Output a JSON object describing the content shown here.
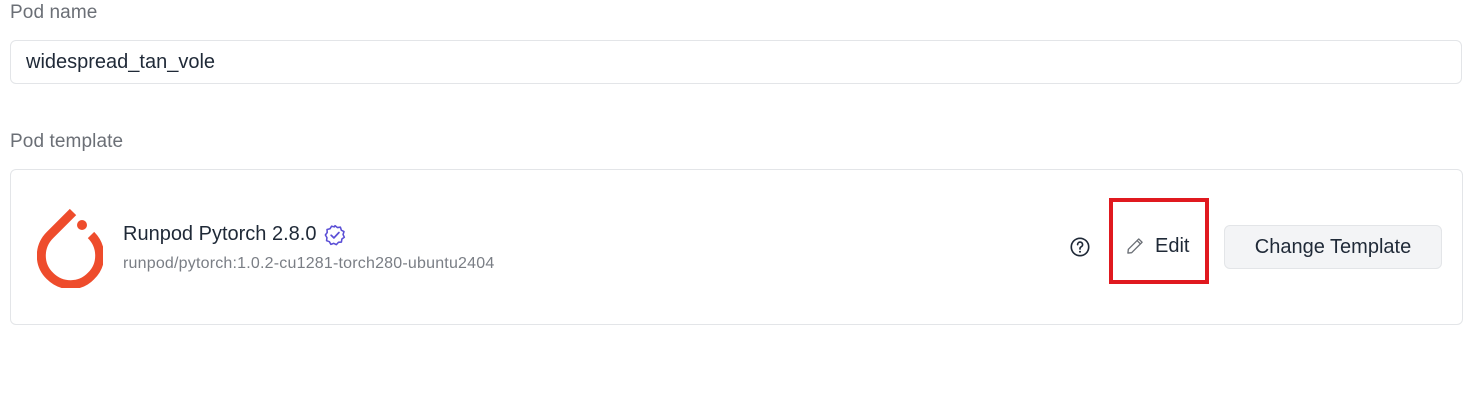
{
  "pod_name": {
    "label": "Pod name",
    "value": "widespread_tan_vole"
  },
  "pod_template": {
    "label": "Pod template",
    "logo_icon": "pytorch-logo",
    "logo_color": "#ee4c2c",
    "name": "Runpod Pytorch 2.8.0",
    "verified_icon": "verified-badge-icon",
    "verified_color": "#5b4fd6",
    "image": "runpod/pytorch:1.0.2-cu1281-torch280-ubuntu2404",
    "help_icon": "question-circle-icon",
    "edit_label": "Edit",
    "edit_icon": "pencil-icon",
    "change_template_label": "Change Template",
    "highlight_color": "#e0191f"
  }
}
